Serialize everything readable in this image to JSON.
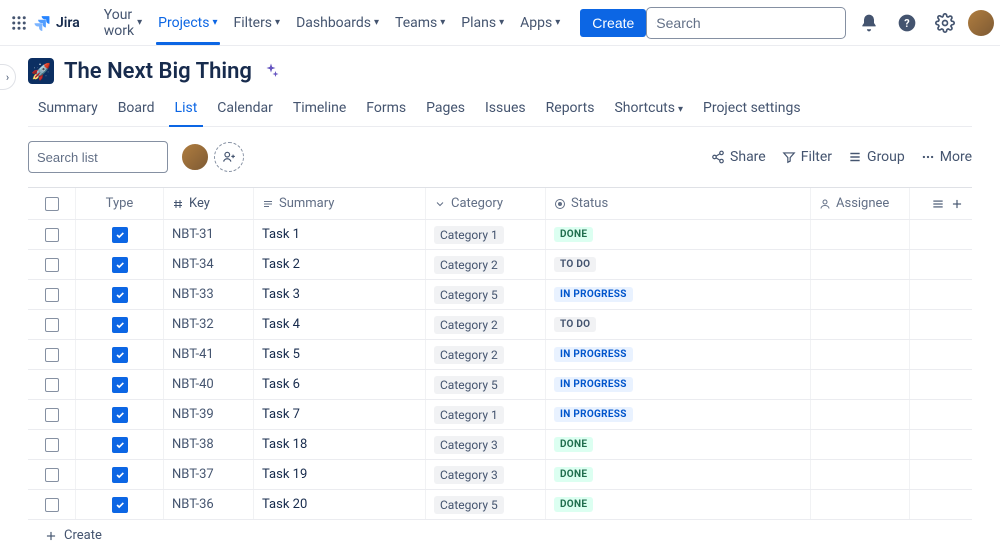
{
  "topnav": {
    "logo": "Jira",
    "items": [
      {
        "label": "Your work",
        "active": false
      },
      {
        "label": "Projects",
        "active": true
      },
      {
        "label": "Filters",
        "active": false
      },
      {
        "label": "Dashboards",
        "active": false
      },
      {
        "label": "Teams",
        "active": false
      },
      {
        "label": "Plans",
        "active": false
      },
      {
        "label": "Apps",
        "active": false
      }
    ],
    "create": "Create",
    "search_placeholder": "Search"
  },
  "project": {
    "title": "The Next Big Thing"
  },
  "tabs": [
    {
      "label": "Summary",
      "active": false
    },
    {
      "label": "Board",
      "active": false
    },
    {
      "label": "List",
      "active": true
    },
    {
      "label": "Calendar",
      "active": false
    },
    {
      "label": "Timeline",
      "active": false
    },
    {
      "label": "Forms",
      "active": false
    },
    {
      "label": "Pages",
      "active": false
    },
    {
      "label": "Issues",
      "active": false
    },
    {
      "label": "Reports",
      "active": false
    },
    {
      "label": "Shortcuts",
      "active": false,
      "dropdown": true
    },
    {
      "label": "Project settings",
      "active": false
    }
  ],
  "toolbar": {
    "search_placeholder": "Search list",
    "share": "Share",
    "filter": "Filter",
    "group": "Group",
    "more": "More"
  },
  "columns": {
    "type": "Type",
    "key": "Key",
    "summary": "Summary",
    "category": "Category",
    "status": "Status",
    "assignee": "Assignee"
  },
  "rows": [
    {
      "key": "NBT-31",
      "summary": "Task 1",
      "category": "Category 1",
      "status": "DONE",
      "status_class": "done"
    },
    {
      "key": "NBT-34",
      "summary": "Task 2",
      "category": "Category 2",
      "status": "TO DO",
      "status_class": "todo"
    },
    {
      "key": "NBT-33",
      "summary": "Task 3",
      "category": "Category 5",
      "status": "IN PROGRESS",
      "status_class": "inprogress"
    },
    {
      "key": "NBT-32",
      "summary": "Task 4",
      "category": "Category 2",
      "status": "TO DO",
      "status_class": "todo"
    },
    {
      "key": "NBT-41",
      "summary": "Task 5",
      "category": "Category 2",
      "status": "IN PROGRESS",
      "status_class": "inprogress"
    },
    {
      "key": "NBT-40",
      "summary": "Task 6",
      "category": "Category 5",
      "status": "IN PROGRESS",
      "status_class": "inprogress"
    },
    {
      "key": "NBT-39",
      "summary": "Task 7",
      "category": "Category 1",
      "status": "IN PROGRESS",
      "status_class": "inprogress"
    },
    {
      "key": "NBT-38",
      "summary": "Task 18",
      "category": "Category 3",
      "status": "DONE",
      "status_class": "done"
    },
    {
      "key": "NBT-37",
      "summary": "Task 19",
      "category": "Category 3",
      "status": "DONE",
      "status_class": "done"
    },
    {
      "key": "NBT-36",
      "summary": "Task 20",
      "category": "Category 5",
      "status": "DONE",
      "status_class": "done"
    }
  ],
  "create_row": "Create"
}
